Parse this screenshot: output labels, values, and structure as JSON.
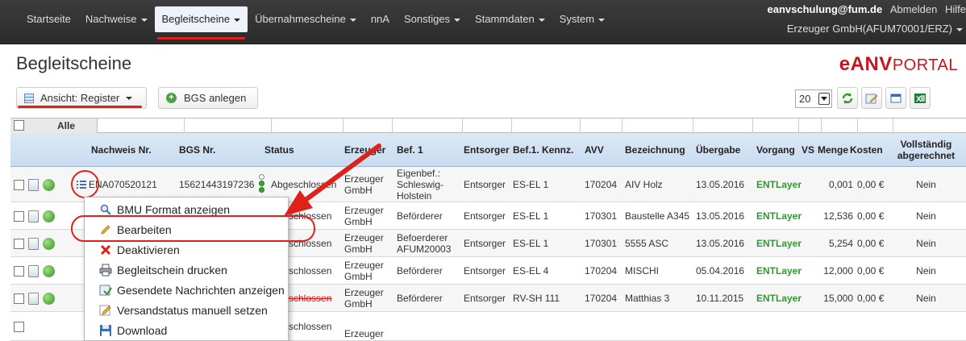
{
  "nav": {
    "items": [
      {
        "label": "Startseite",
        "caret": false,
        "active": false
      },
      {
        "label": "Nachweise",
        "caret": true,
        "active": false
      },
      {
        "label": "Begleitscheine",
        "caret": true,
        "active": true
      },
      {
        "label": "Übernahmescheine",
        "caret": true,
        "active": false
      },
      {
        "label": "nnA",
        "caret": false,
        "active": false
      },
      {
        "label": "Sonstiges",
        "caret": true,
        "active": false
      },
      {
        "label": "Stammdaten",
        "caret": true,
        "active": false
      },
      {
        "label": "System",
        "caret": true,
        "active": false
      }
    ],
    "user_email": "eanvschulung@fum.de",
    "logout_label": "Abmelden",
    "help_label": "Hilfe",
    "company": "Erzeuger GmbH(AFUM70001/ERZ)"
  },
  "page": {
    "title": "Begleitscheine",
    "logo_main": "eANV",
    "logo_sub": "PORTAL"
  },
  "toolbar": {
    "view_label": "Ansicht: Register",
    "create_label": "BGS anlegen",
    "page_size": "20"
  },
  "table": {
    "select_all_label": "Alle",
    "columns": [
      "Nachweis Nr.",
      "BGS Nr.",
      "Status",
      "Erzeuger",
      "Bef. 1",
      "Entsorger",
      "Bef.1. Kennz.",
      "AVV",
      "Bezeichnung",
      "Übergabe",
      "Vorgang",
      "VS",
      "Menge",
      "Kosten",
      "Vollständig abgerechnet"
    ],
    "rows": [
      {
        "nachweis": "ENA070520121",
        "bgs": "15621443197236",
        "status": "Abgeschlossen",
        "erzeuger": "Erzeuger GmbH",
        "bef1": "Eigenbef.: Schleswig-Holstein",
        "entsorger": "Entsorger",
        "kennz": "ES-EL 1",
        "avv": "170204",
        "bezeichnung": "AIV Holz",
        "uebergabe": "13.05.2016",
        "vorgang": "ENTLayer",
        "menge": "0,001",
        "kosten": "0,00 €",
        "abgerechnet": "Nein"
      },
      {
        "nachweis": "",
        "bgs": "",
        "status": "schlossen",
        "erzeuger": "Erzeuger GmbH",
        "bef1": "Beförderer",
        "entsorger": "Entsorger",
        "kennz": "ES-EL 1",
        "avv": "170301",
        "bezeichnung": "Baustelle A345",
        "uebergabe": "13.05.2016",
        "vorgang": "ENTLayer",
        "menge": "12,536",
        "kosten": "0,00 €",
        "abgerechnet": "Nein"
      },
      {
        "nachweis": "",
        "bgs": "",
        "status": "schlossen",
        "erzeuger": "Erzeuger GmbH",
        "bef1": "Befoerderer AFUM20003",
        "entsorger": "Entsorger",
        "kennz": "ES-EL 1",
        "avv": "170301",
        "bezeichnung": "5555 ASC",
        "uebergabe": "13.05.2016",
        "vorgang": "ENTLayer",
        "menge": "5,254",
        "kosten": "0,00 €",
        "abgerechnet": "Nein"
      },
      {
        "nachweis": "",
        "bgs": "",
        "status": "schlossen",
        "erzeuger": "Erzeuger GmbH",
        "bef1": "Beförderer",
        "entsorger": "Entsorger",
        "kennz": "ES-EL 4",
        "avv": "170204",
        "bezeichnung": "MISCHI",
        "uebergabe": "05.04.2016",
        "vorgang": "ENTLayer",
        "menge": "12,000",
        "kosten": "0,00 €",
        "abgerechnet": "Nein"
      },
      {
        "nachweis": "",
        "bgs": "",
        "status": "schlossen",
        "erzeuger": "Erzeuger GmbH",
        "bef1": "Beförderer",
        "entsorger": "Entsorger",
        "kennz": "RV-SH 111",
        "avv": "170204",
        "bezeichnung": "Matthias 3",
        "uebergabe": "10.11.2015",
        "vorgang": "ENTLayer",
        "menge": "15,000",
        "kosten": "0,00 €",
        "abgerechnet": "Nein"
      },
      {
        "nachweis": "",
        "bgs": "",
        "status": "schlossen",
        "erzeuger": "Erzeuger",
        "bef1": "",
        "entsorger": "",
        "kennz": "",
        "avv": "",
        "bezeichnung": "",
        "uebergabe": "",
        "vorgang": "",
        "menge": "",
        "kosten": "",
        "abgerechnet": ""
      }
    ]
  },
  "context_menu": {
    "items": [
      {
        "label": "BMU Format anzeigen",
        "icon": "magnifier-icon"
      },
      {
        "label": "Bearbeiten",
        "icon": "pencil-icon"
      },
      {
        "label": "Deaktivieren",
        "icon": "red-x-icon"
      },
      {
        "label": "Begleitschein drucken",
        "icon": "printer-icon"
      },
      {
        "label": "Gesendete Nachrichten anzeigen",
        "icon": "messages-icon"
      },
      {
        "label": "Versandstatus manuell setzen",
        "icon": "pencil-status-icon"
      },
      {
        "label": "Download",
        "icon": "floppy-disk-icon"
      }
    ]
  },
  "colors": {
    "accent_red": "#e0201b",
    "nav_bg": "#2f2f2f",
    "header_blue": "#cfe0f2",
    "vorgang_green": "#2f9a2f"
  }
}
